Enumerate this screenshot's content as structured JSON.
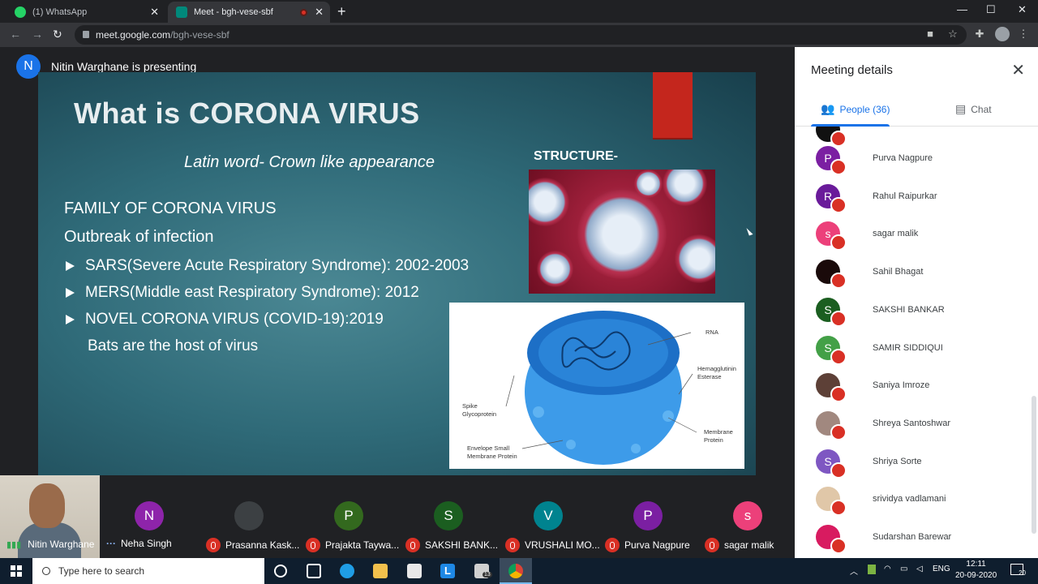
{
  "browser": {
    "tabs": [
      {
        "title": "(1) WhatsApp",
        "icon": "whatsapp-icon"
      },
      {
        "title": "Meet - bgh-vese-sbf",
        "icon": "meet-icon",
        "active": true
      }
    ],
    "url_host": "meet.google.com",
    "url_path": "/bgh-vese-sbf"
  },
  "presenter": {
    "initial": "N",
    "status": "Nitin Warghane is presenting"
  },
  "slide": {
    "title": "What is CORONA VIRUS",
    "subtitle": "Latin word- Crown like appearance",
    "heading1": "FAMILY OF CORONA VIRUS",
    "heading2": "Outbreak of infection",
    "bullets": [
      "SARS(Severe Acute Respiratory Syndrome): 2002-2003",
      "MERS(Middle east Respiratory Syndrome): 2012",
      "NOVEL CORONA VIRUS (COVID-19):2019"
    ],
    "note": "Bats are the host of virus",
    "structure_label": "STRUCTURE-",
    "diagram_labels": {
      "rna": "RNA",
      "hemagglutinin": "Hemagglutinin Esterase",
      "spike": "Spike Glycoprotein",
      "membrane": "Membrane Protein",
      "envelope": "Envelope Small Membrane Protein"
    }
  },
  "filmstrip": {
    "self": {
      "name": "Nitin Warghane"
    },
    "tiles": [
      {
        "initial": "N",
        "name": "Neha Singh",
        "color": "#8e24aa",
        "muted": false
      },
      {
        "initial": "",
        "name": "Prasanna Kask...",
        "color": "#3c4043",
        "muted": true
      },
      {
        "initial": "P",
        "name": "Prajakta Taywa...",
        "color": "#33691e",
        "muted": true
      },
      {
        "initial": "S",
        "name": "SAKSHI BANK...",
        "color": "#1b5e20",
        "muted": true
      },
      {
        "initial": "V",
        "name": "VRUSHALI MO...",
        "color": "#00838f",
        "muted": true
      },
      {
        "initial": "P",
        "name": "Purva Nagpure",
        "color": "#7b1fa2",
        "muted": true
      },
      {
        "initial": "s",
        "name": "sagar malik",
        "color": "#ec407a",
        "muted": true
      }
    ]
  },
  "panel": {
    "title": "Meeting details",
    "people_tab": "People (36)",
    "chat_tab": "Chat",
    "people": [
      {
        "initial": "P",
        "name": "Purva Nagpure",
        "color": "#7b1fa2"
      },
      {
        "initial": "R",
        "name": "Rahul Raipurkar",
        "color": "#6a1b9a"
      },
      {
        "initial": "s",
        "name": "sagar malik",
        "color": "#ec407a"
      },
      {
        "initial": "",
        "name": "Sahil Bhagat",
        "color": "#1a0a0a"
      },
      {
        "initial": "S",
        "name": "SAKSHI BANKAR",
        "color": "#1b5e20"
      },
      {
        "initial": "S",
        "name": "SAMIR SIDDIQUI",
        "color": "#43a047"
      },
      {
        "initial": "",
        "name": "Saniya Imroze",
        "color": "#5d4037"
      },
      {
        "initial": "",
        "name": "Shreya Santoshwar",
        "color": "#a1887f"
      },
      {
        "initial": "S",
        "name": "Shriya Sorte",
        "color": "#7e57c2"
      },
      {
        "initial": "",
        "name": "srividya vadlamani",
        "color": "#e0c7a8"
      },
      {
        "initial": "",
        "name": "Sudarshan Barewar",
        "color": "#d81b60"
      }
    ]
  },
  "taskbar": {
    "search_placeholder": "Type here to search",
    "language": "ENG",
    "time": "12:11",
    "date": "20-09-2020",
    "notifications": "20",
    "mail_badge": "13"
  }
}
